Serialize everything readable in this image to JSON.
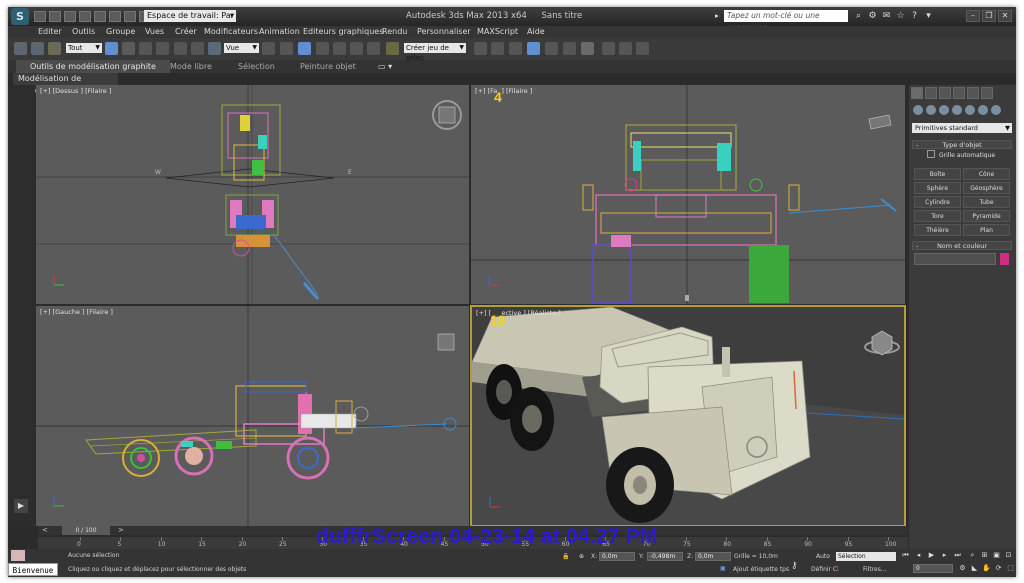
{
  "titlebar": {
    "logo": "S",
    "workspace": "Espace de travail: Par",
    "app_title": "Autodesk 3ds Max  2013 x64",
    "doc_title": "Sans titre",
    "search_placeholder": "Tapez un mot-clé ou une expression"
  },
  "menu": [
    "Editer",
    "Outils",
    "Groupe",
    "Vues",
    "Créer",
    "Modificateurs",
    "Animation",
    "Editeurs graphiques",
    "Rendu",
    "Personnaliser",
    "MAXScript",
    "Aide"
  ],
  "toolbar": {
    "selection_filter": "Tout",
    "ref_coord": "Vue",
    "named_selection": "Créer jeu de sélec"
  },
  "ribbon": {
    "tabs": [
      "Outils de modélisation graphite",
      "Mode libre",
      "Sélection",
      "Peinture objet"
    ],
    "active_tab": 0,
    "subpanel": "Modélisation de polygone"
  },
  "viewports": {
    "top": {
      "label": "[+] [Dessus ] [Filaire ]",
      "axis_w": "W",
      "axis_e": "E"
    },
    "front": {
      "label": "[+] [Fa",
      "label_tail": "] [Filaire ]",
      "frame": "4"
    },
    "left": {
      "label": "[+] [Gauche ] [Filaire ]"
    },
    "persp": {
      "label": "[+] [",
      "label_tail": "ective ] [Réaliste ]",
      "frame": "18",
      "colors": {
        "truck": "#d8d6c4",
        "bg": "#3f3f3f"
      }
    }
  },
  "command_panel": {
    "dropdown": "Primitives standard",
    "section_type": "Type d'objet",
    "autogrid": "Grille automatique",
    "buttons": [
      "Boîte",
      "Cône",
      "Sphère",
      "Géosphère",
      "Cylindre",
      "Tube",
      "Tore",
      "Pyramide",
      "Théière",
      "Plan"
    ],
    "section_name": "Nom et couleur",
    "object_color": "#cc2f7f"
  },
  "timeline": {
    "slider": "0 / 100",
    "ticks": [
      "0",
      "5",
      "10",
      "15",
      "20",
      "25",
      "30",
      "35",
      "40",
      "45",
      "50",
      "55",
      "60",
      "65",
      "70",
      "75",
      "80",
      "85",
      "90",
      "95",
      "100"
    ]
  },
  "status": {
    "welcome": "Bienvenue",
    "selection": "Aucune sélection",
    "prompt": "Cliquez ou cliquez et déplacez pour sélectionner des objets",
    "x_label": "X:",
    "x_val": "0,0m",
    "y_label": "Y:",
    "y_val": "-0,498m",
    "z_label": "Z:",
    "z_val": "0,0m",
    "grid": "Grille = 10,0m",
    "add_time_tag": "Ajout étiquette tps",
    "auto": "Auto",
    "key_mode": "Sélection",
    "set_key": "Définir C.",
    "filters": "Filtres...",
    "frame": "0"
  },
  "watermark": "dufffrScreen 04-23-14 at 04.27 PM"
}
